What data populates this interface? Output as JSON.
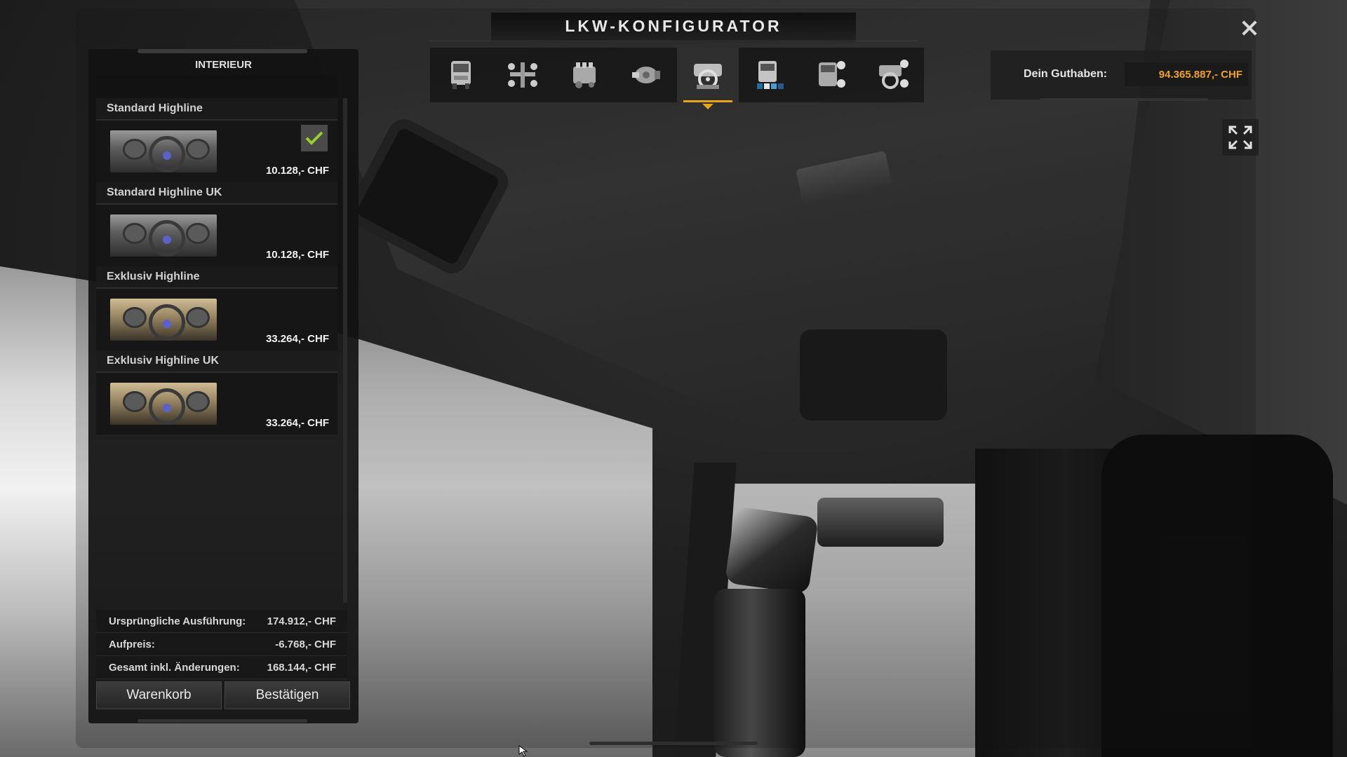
{
  "window": {
    "title": "LKW-KONFIGURATOR",
    "close_icon": "close-icon"
  },
  "toolbar": {
    "active_index": 4,
    "accent_color": "#e8a41a",
    "categories": [
      {
        "icon": "truck-cabin-icon"
      },
      {
        "icon": "chassis-axle-icon"
      },
      {
        "icon": "engine-icon"
      },
      {
        "icon": "transmission-icon"
      },
      {
        "icon": "interior-icon"
      },
      {
        "icon": "paint-icon"
      },
      {
        "icon": "accessories-icon"
      },
      {
        "icon": "interior-accessories-icon"
      }
    ]
  },
  "balance": {
    "label": "Dein Guthaben:",
    "value": "94.365.887,- CHF",
    "value_color": "#f0a320"
  },
  "fullscreen_icon": "fullscreen-icon",
  "panel": {
    "title": "INTERIEUR",
    "options": [
      {
        "name": "Standard Highline",
        "price": "10.128,- CHF",
        "selected": true,
        "theme": "grey"
      },
      {
        "name": "Standard Highline UK",
        "price": "10.128,- CHF",
        "selected": false,
        "theme": "grey"
      },
      {
        "name": "Exklusiv Highline",
        "price": "33.264,- CHF",
        "selected": false,
        "theme": "beige"
      },
      {
        "name": "Exklusiv Highline UK",
        "price": "33.264,- CHF",
        "selected": false,
        "theme": "beige"
      }
    ]
  },
  "summary": {
    "original_label": "Ursprüngliche Ausführung:",
    "original_value": "174.912,- CHF",
    "surcharge_label": "Aufpreis:",
    "surcharge_value": "-6.768,- CHF",
    "total_label": "Gesamt inkl. Änderungen:",
    "total_value": "168.144,- CHF"
  },
  "buttons": {
    "cart": "Warenkorb",
    "confirm": "Bestätigen"
  }
}
